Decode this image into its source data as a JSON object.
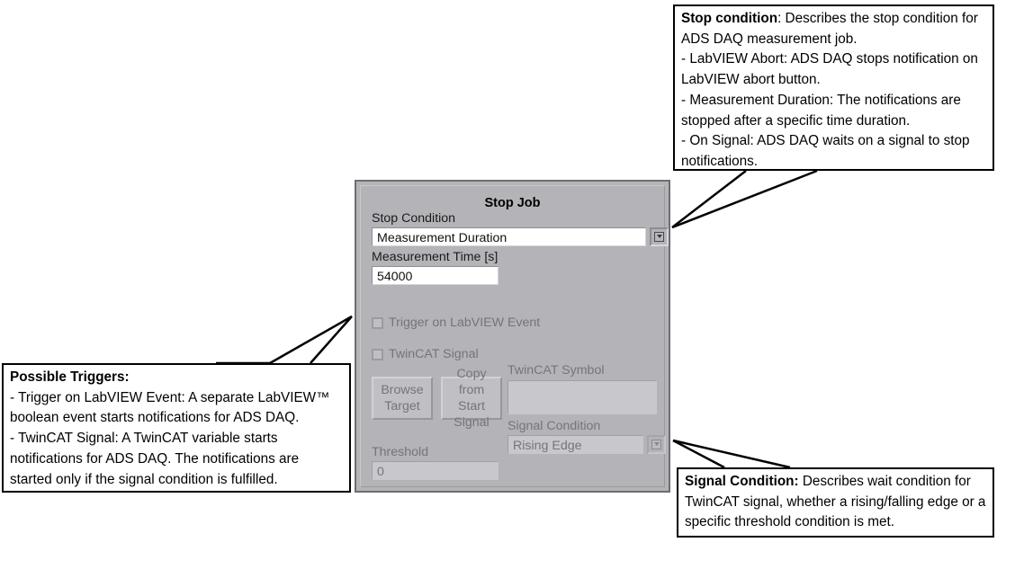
{
  "panel": {
    "title": "Stop Job",
    "stop_condition": {
      "label": "Stop Condition",
      "value": "Measurement Duration",
      "arrow_icon": "chevron-down-icon"
    },
    "measurement_time": {
      "label": "Measurement Time [s]",
      "value": "54000"
    },
    "trigger_labview_event": {
      "label": "Trigger on LabVIEW Event",
      "checked": false
    },
    "twincat_signal": {
      "label": "TwinCAT Signal",
      "checked": false
    },
    "browse_target_button": "Browse\nTarget",
    "copy_from_start_signal_button": "Copy from\nStart Signal",
    "twincat_symbol": {
      "label": "TwinCAT Symbol",
      "value": ""
    },
    "signal_condition": {
      "label": "Signal Condition",
      "value": "Rising Edge",
      "arrow_icon": "chevron-down-icon"
    },
    "threshold": {
      "label": "Threshold",
      "value": "0"
    }
  },
  "callouts": {
    "stop_condition": {
      "heading": "Stop condition",
      "body": ": Describes the stop condition for ADS DAQ measurement job.\n- LabVIEW Abort: ADS DAQ stops notification on LabVIEW abort button.\n- Measurement Duration: The notifications are stopped after a specific time duration.\n- On Signal: ADS DAQ waits on a signal to stop notifications."
    },
    "possible_triggers": {
      "heading": "Possible Triggers:",
      "body": "\n- Trigger on LabVIEW Event: A separate LabVIEW™ boolean event starts notifications for ADS DAQ.\n- TwinCAT Signal: A TwinCAT variable starts notifications for ADS DAQ. The notifications are started only if the signal condition is fulfilled."
    },
    "signal_condition": {
      "heading": "Signal Condition:",
      "body": " Describes wait condition for TwinCAT signal, whether a rising/falling edge or a specific threshold condition is met."
    }
  },
  "colors": {
    "panel_background": "#b4b4b8",
    "panel_border": "#6e6e72",
    "field_background": "#ffffff",
    "disabled_field_background": "#c8c8cc",
    "disabled_text": "#757578",
    "callout_border": "#000000"
  }
}
